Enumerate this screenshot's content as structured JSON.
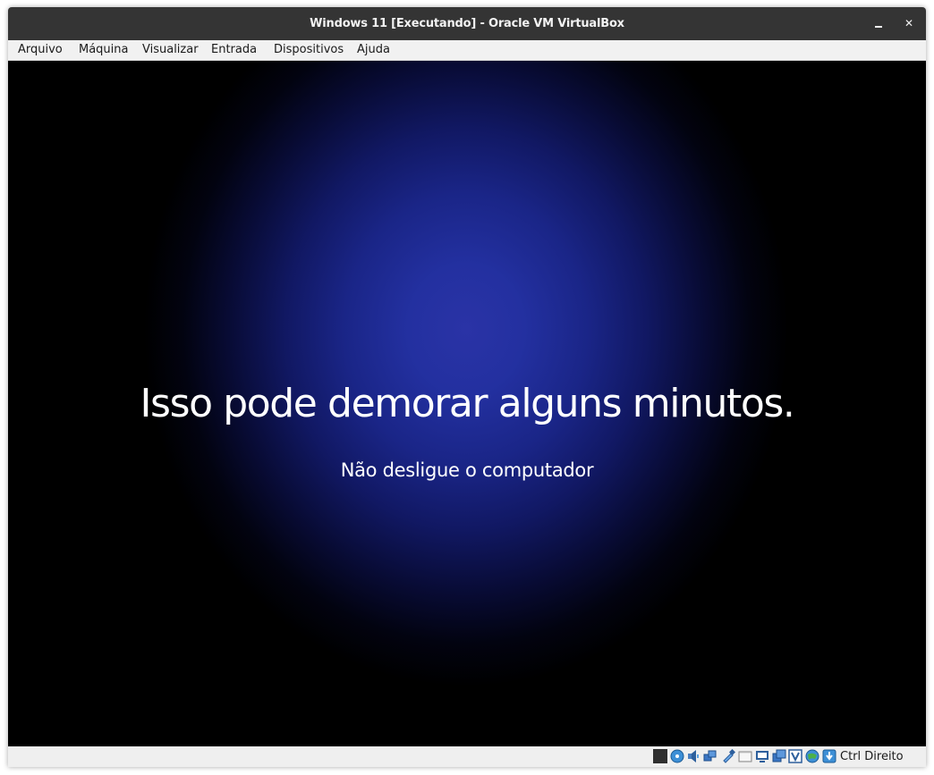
{
  "window": {
    "title": "Windows 11 [Executando] - Oracle VM VirtualBox",
    "minimize_glyph": "―",
    "close_glyph": "✕"
  },
  "menubar": {
    "items": [
      {
        "label": "Arquivo"
      },
      {
        "label": "Máquina"
      },
      {
        "label": "Visualizar"
      },
      {
        "label": "Entrada"
      },
      {
        "label": "Dispositivos"
      },
      {
        "label": "Ajuda"
      }
    ]
  },
  "guest_screen": {
    "message": "Isso pode demorar alguns minutos.",
    "submessage": "Não desligue o computador",
    "background_center_color": "#2a33a6",
    "background_edge_color": "#000000"
  },
  "statusbar": {
    "icons": [
      "capture-indicator-icon",
      "optical-drive-icon",
      "audio-icon",
      "network-icon",
      "usb-icon",
      "shared-folders-icon",
      "display-icon",
      "video-capture-icon",
      "virtualization-icon",
      "mouse-integration-icon",
      "download-indicator-icon"
    ],
    "host_key_label": "Ctrl Direito"
  }
}
